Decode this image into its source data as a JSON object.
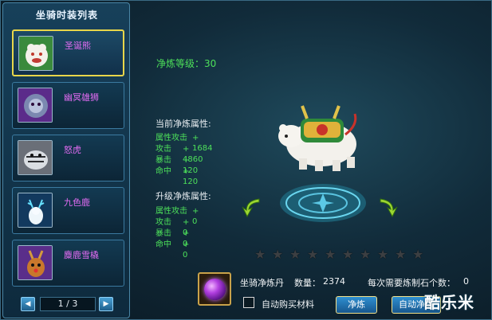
{
  "panel": {
    "title": "坐骑时装列表"
  },
  "mounts": [
    {
      "name": "圣诞熊",
      "icon": "bear-mount-icon",
      "selected": true
    },
    {
      "name": "幽冥雄狮",
      "icon": "lion-mount-icon",
      "selected": false
    },
    {
      "name": "怒虎",
      "icon": "tiger-mount-icon",
      "selected": false
    },
    {
      "name": "九色鹿",
      "icon": "nine-color-deer-icon",
      "selected": false
    },
    {
      "name": "麋鹿雪橇",
      "icon": "reindeer-sleigh-icon",
      "selected": false
    }
  ],
  "pager": {
    "text": "1 / 3"
  },
  "level": {
    "label": "净炼等级：",
    "value": "30"
  },
  "current": {
    "title": "当前净炼属性:",
    "rows": [
      {
        "name": "属性攻击",
        "value": "+ 1684"
      },
      {
        "name": "攻击",
        "value": "+ 4860"
      },
      {
        "name": "暴击",
        "value": "+ 120"
      },
      {
        "name": "命中",
        "value": "+ 120"
      }
    ]
  },
  "upgrade": {
    "title": "升级净炼属性:",
    "rows": [
      {
        "name": "属性攻击",
        "value": "+ 0"
      },
      {
        "name": "攻击",
        "value": "+ 0"
      },
      {
        "name": "暴击",
        "value": "+ 0"
      },
      {
        "name": "命中",
        "value": "+ 0"
      }
    ]
  },
  "stars": {
    "filled": 0,
    "total": 10
  },
  "material": {
    "name": "坐骑净炼丹",
    "count_label": "数量：",
    "count": "2374",
    "need_label": "每次需要炼制石个数：",
    "need": "0"
  },
  "auto_buy": {
    "label": "自动购买材料",
    "checked": false
  },
  "buttons": {
    "refine": "净炼",
    "auto_refine": "自动净炼"
  },
  "watermark": "酷乐米"
}
